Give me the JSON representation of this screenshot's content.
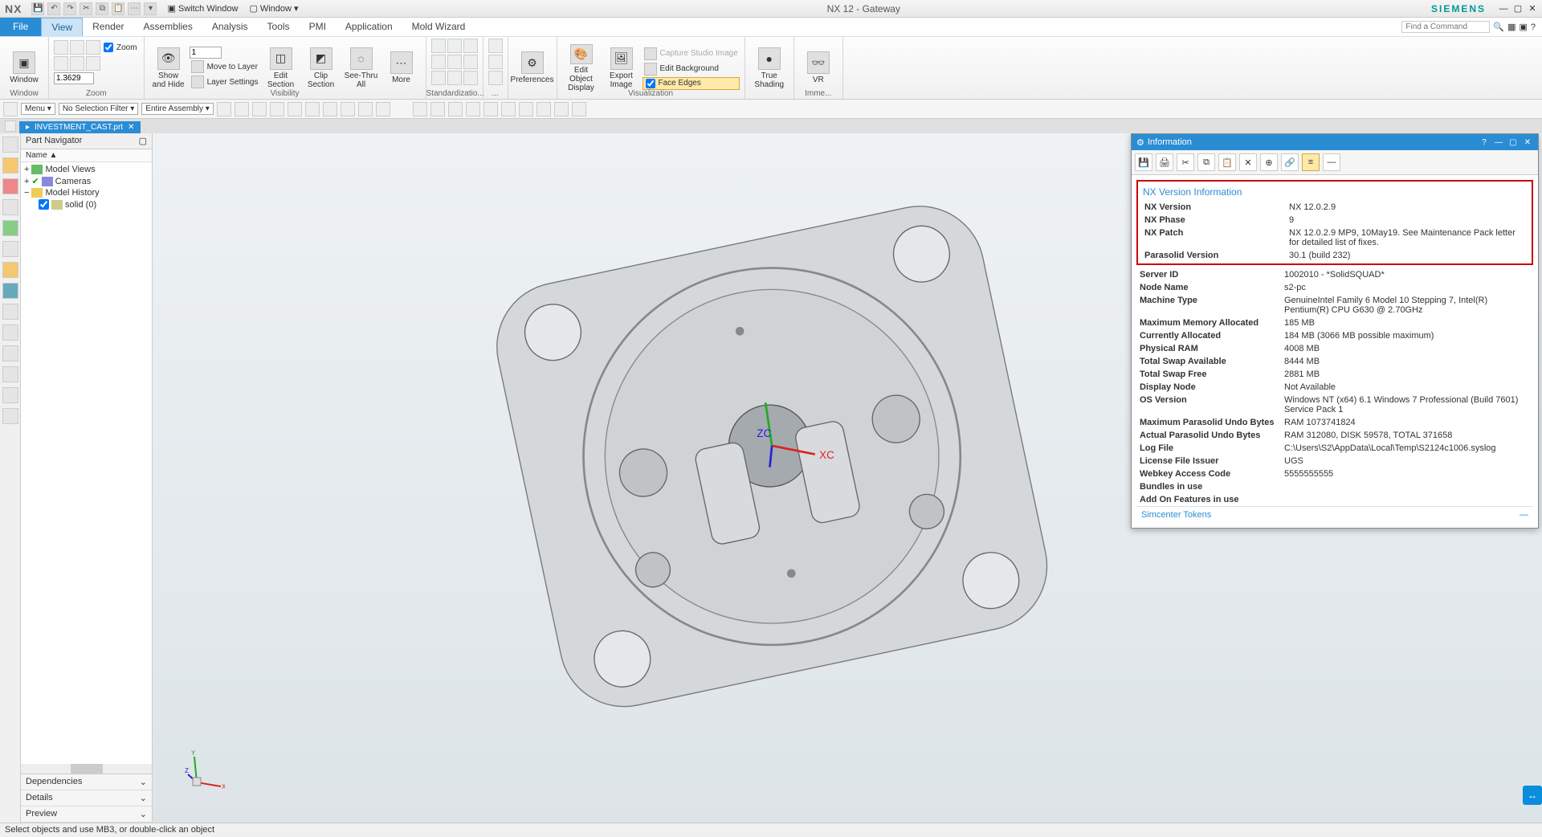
{
  "app": {
    "logo": "NX",
    "title": "NX 12 - Gateway",
    "brand": "SIEMENS",
    "switch_window": "Switch Window",
    "window_menu": "Window ▾",
    "find_placeholder": "Find a Command"
  },
  "qat_icons": [
    "save",
    "undo",
    "redo",
    "cut",
    "copy",
    "paste",
    "more"
  ],
  "tabs": {
    "file": "File",
    "items": [
      "View",
      "Render",
      "Assemblies",
      "Analysis",
      "Tools",
      "PMI",
      "Application",
      "Mold Wizard"
    ],
    "active": "View"
  },
  "ribbon": {
    "window": {
      "label": "Window",
      "btn": "Window"
    },
    "zoom": {
      "label": "Zoom",
      "zoom_chk": "Zoom",
      "value": "1.3629"
    },
    "visibility": {
      "label": "Visibility",
      "show_hide": "Show\nand Hide",
      "scale": "1",
      "move_layer": "Move to Layer",
      "layer_settings": "Layer Settings",
      "edit_section": "Edit\nSection",
      "clip_section": "Clip\nSection",
      "see_thru": "See-Thru\nAll",
      "more": "More"
    },
    "standardization": {
      "label": "Standardizatio..."
    },
    "preferences": {
      "label": "",
      "btn": "Preferences"
    },
    "visualization": {
      "label": "Visualization",
      "edit_obj": "Edit Object\nDisplay",
      "export_img": "Export\nImage",
      "capture": "Capture Studio Image",
      "edit_bg": "Edit Background",
      "face_edges": "Face Edges"
    },
    "true_shading": {
      "label": "",
      "btn": "True\nShading"
    },
    "immersive": {
      "label": "Imme...",
      "vr": "VR"
    }
  },
  "toolbar2": {
    "menu": "Menu ▾",
    "filter": "No Selection Filter ▾",
    "assembly": "Entire Assembly ▾"
  },
  "doc_tab": {
    "name": "INVESTMENT_CAST.prt"
  },
  "nav": {
    "title": "Part Navigator",
    "col": "Name   ▲",
    "tree": {
      "model_views": "Model Views",
      "cameras": "Cameras",
      "model_history": "Model History",
      "solid": "solid (0)"
    },
    "sections": {
      "deps": "Dependencies",
      "details": "Details",
      "preview": "Preview"
    }
  },
  "info": {
    "title": "Information",
    "section_head": "NX Version Information",
    "rows_boxed": [
      {
        "k": "NX Version",
        "v": "NX 12.0.2.9"
      },
      {
        "k": "NX Phase",
        "v": "9"
      },
      {
        "k": "NX Patch",
        "v": "NX 12.0.2.9 MP9, 10May19. See Maintenance Pack letter for detailed list of fixes."
      },
      {
        "k": "Parasolid Version",
        "v": "30.1 (build 232)"
      }
    ],
    "rows": [
      {
        "k": "Server ID",
        "v": "1002010 - *SolidSQUAD*"
      },
      {
        "k": "Node Name",
        "v": "s2-pc"
      },
      {
        "k": "Machine Type",
        "v": "GenuineIntel Family 6 Model 10 Stepping 7, Intel(R) Pentium(R) CPU G630 @ 2.70GHz"
      },
      {
        "k": "Maximum Memory Allocated",
        "v": "185 MB"
      },
      {
        "k": "Currently Allocated",
        "v": "184 MB (3066 MB possible maximum)"
      },
      {
        "k": "Physical RAM",
        "v": "4008 MB"
      },
      {
        "k": "Total Swap Available",
        "v": "8444 MB"
      },
      {
        "k": "Total Swap Free",
        "v": "2881 MB"
      },
      {
        "k": "Display Node",
        "v": "Not Available"
      },
      {
        "k": "OS Version",
        "v": "Windows NT (x64) 6.1 Windows 7 Professional (Build 7601) Service Pack 1"
      },
      {
        "k": "Maximum Parasolid Undo Bytes",
        "v": "RAM 1073741824"
      },
      {
        "k": "Actual Parasolid Undo Bytes",
        "v": "RAM 312080, DISK 59578, TOTAL 371658"
      },
      {
        "k": "Log File",
        "v": "C:\\Users\\S2\\AppData\\Local\\Temp\\S2124c1006.syslog"
      },
      {
        "k": "License File Issuer",
        "v": "UGS"
      },
      {
        "k": "Webkey Access Code",
        "v": "5555555555"
      },
      {
        "k": "Bundles in use",
        "v": ""
      },
      {
        "k": "Add On Features in use",
        "v": ""
      }
    ],
    "tokens": "Simcenter Tokens"
  },
  "status": "Select objects and use MB3, or double-click an object"
}
